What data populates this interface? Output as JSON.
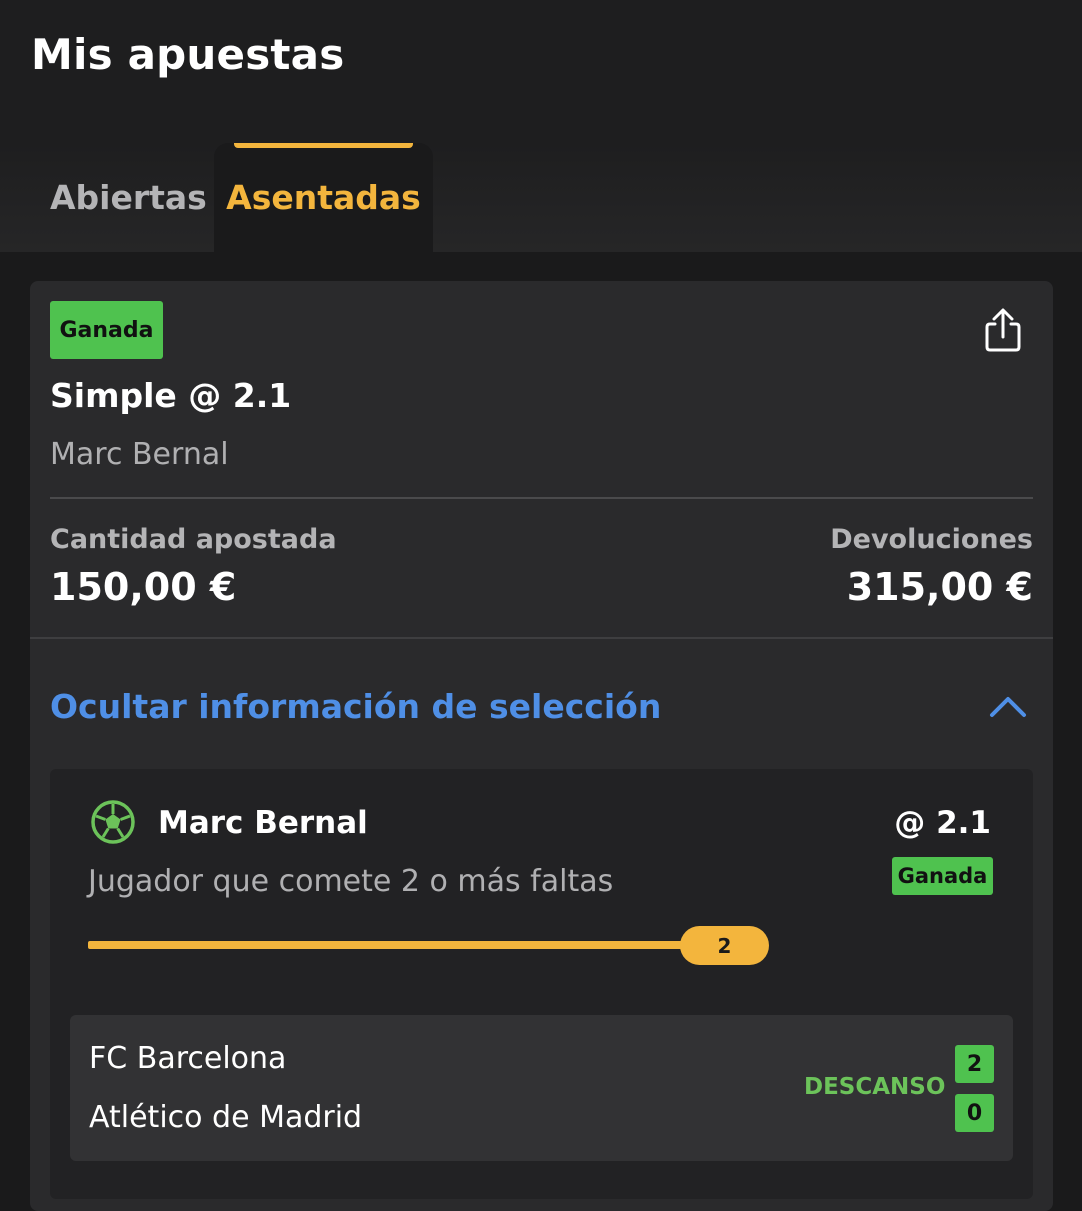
{
  "page": {
    "title": "Mis apuestas"
  },
  "tabs": [
    {
      "label": "Abiertas",
      "active": false
    },
    {
      "label": "Asentadas",
      "active": true
    }
  ],
  "bet": {
    "status": "Ganada",
    "type": "Simple @ 2.1",
    "player": "Marc Bernal",
    "stake_label": "Cantidad apostada",
    "stake_value": "150,00 €",
    "returns_label": "Devoluciones",
    "returns_value": "315,00 €",
    "share_icon": "share-icon",
    "toggle_label": "Ocultar información de selección",
    "toggle_icon": "chevron-up-icon"
  },
  "selection": {
    "sport_icon": "soccer-ball-icon",
    "player": "Marc Bernal",
    "odds": "@ 2.1",
    "status": "Ganada",
    "market": "Jugador que comete 2 o más faltas",
    "progress": {
      "current": "2",
      "target": 2,
      "fraction": 1.0
    }
  },
  "match": {
    "home_team": "FC Barcelona",
    "away_team": "Atlético de Madrid",
    "status": "DESCANSO",
    "home_score": "2",
    "away_score": "0"
  },
  "colors": {
    "accent": "#f3b53d",
    "win_green": "#4fc24f",
    "link_blue": "#4f8fe6",
    "status_green": "#6cc35a"
  }
}
